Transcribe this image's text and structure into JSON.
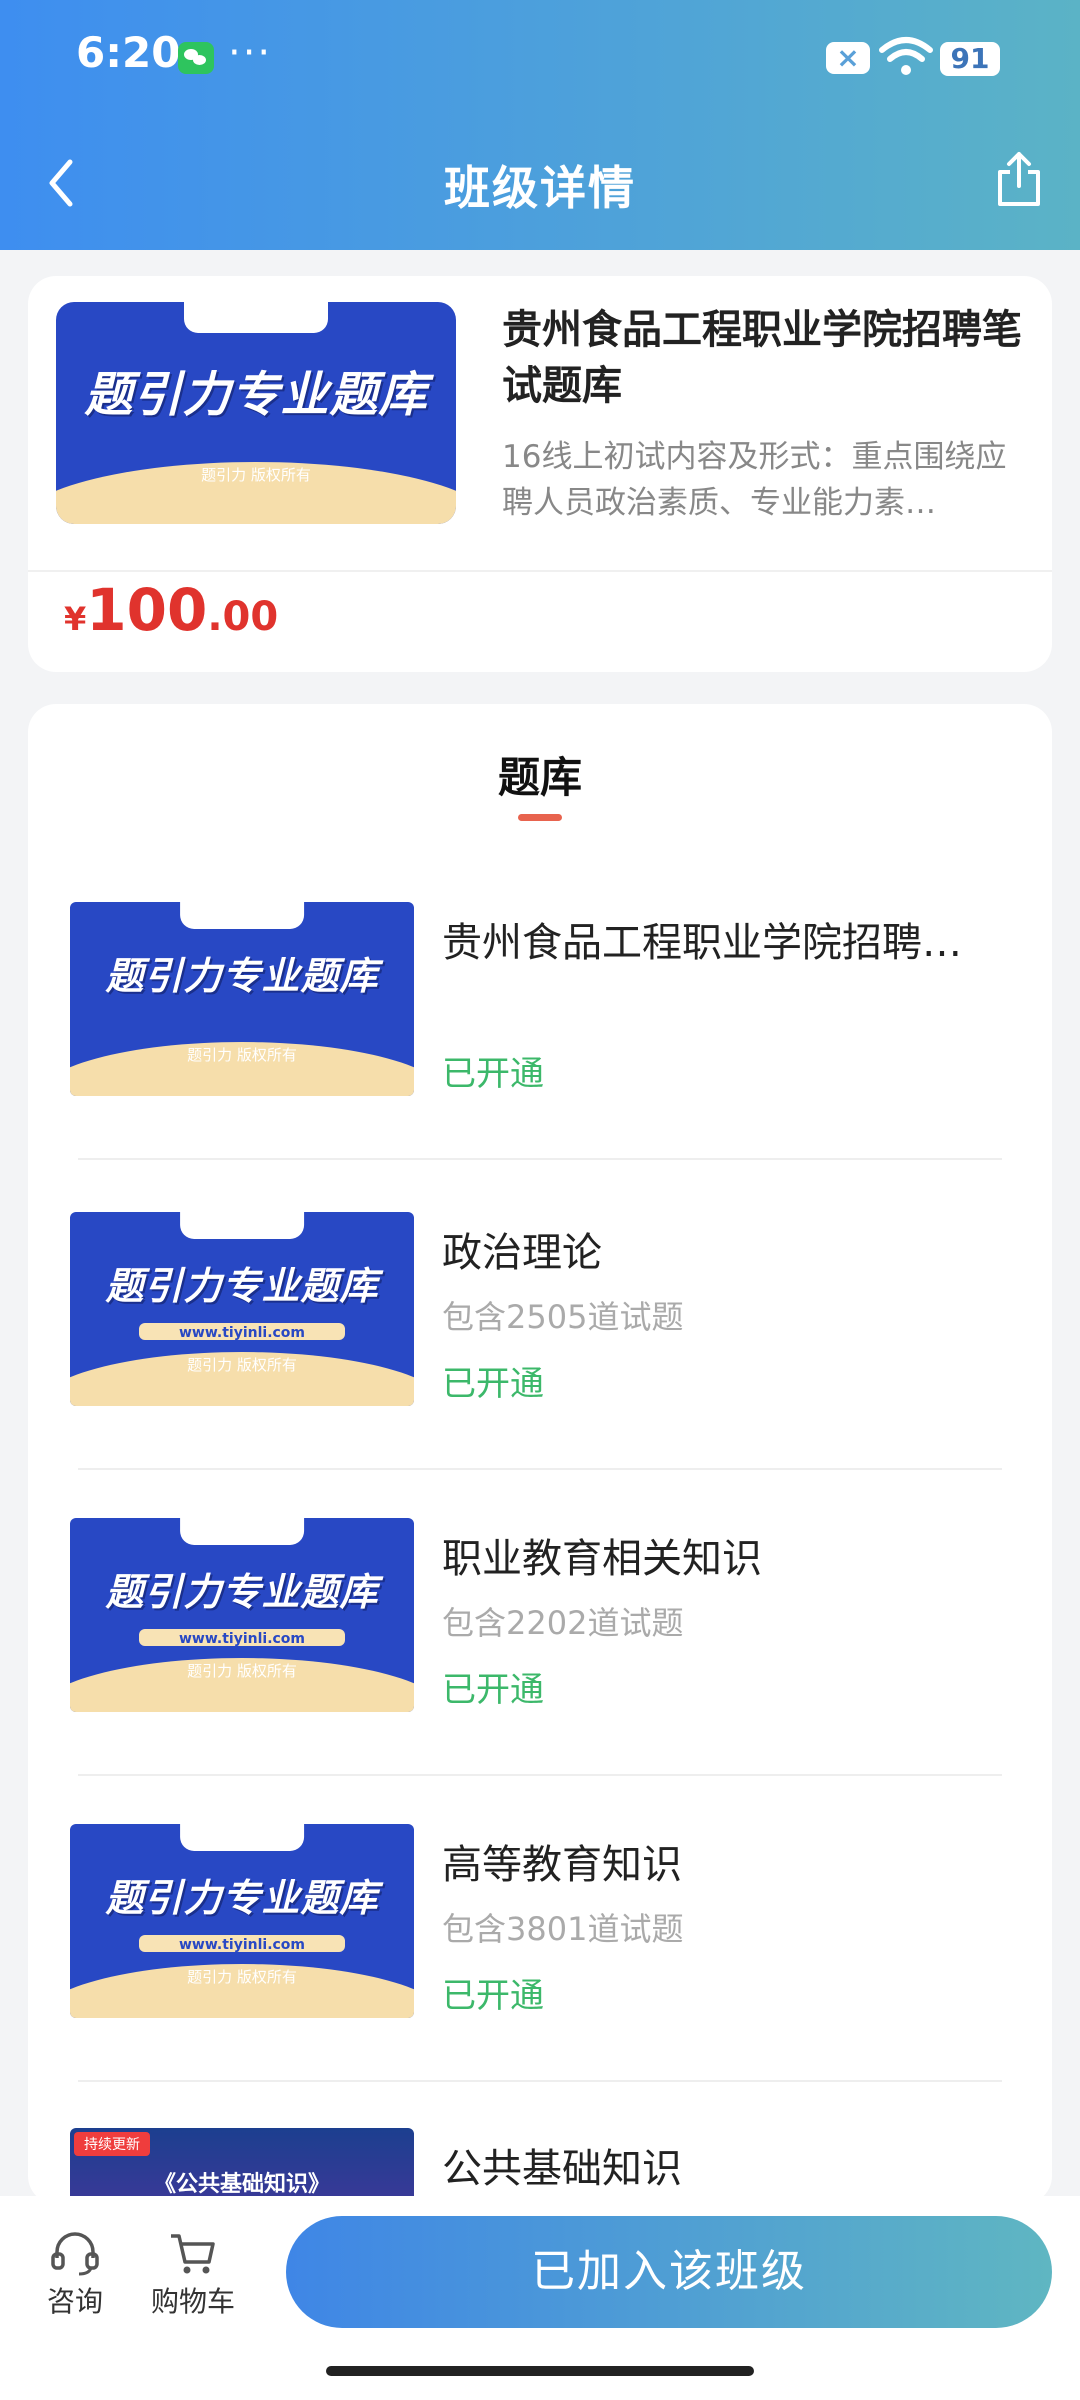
{
  "status_bar": {
    "time": "6:20",
    "more": "···",
    "battery": "91",
    "icons": [
      "wechat-icon",
      "close-badge-icon",
      "wifi-icon",
      "battery-icon"
    ]
  },
  "header": {
    "title": "班级详情",
    "icons": [
      "back-arrow-icon",
      "share-icon"
    ]
  },
  "product": {
    "thumb_text": "题引力专业题库",
    "thumb_copyright": "题引力 版权所有",
    "title": "贵州食品工程职业学院招聘笔试题库",
    "description": "16线上初试内容及形式：重点围绕应聘人员政治素质、专业能力素…",
    "price_symbol": "¥",
    "price_int": "100",
    "price_dec": ".00"
  },
  "bank": {
    "tab_label": "题库",
    "items": [
      {
        "title": "贵州食品工程职业学院招聘…",
        "count": "",
        "status": "已开通",
        "thumb_text": "题引力专业题库",
        "thumb_url": "",
        "thumb_copyright": "题引力 版权所有"
      },
      {
        "title": "政治理论",
        "count": "包含2505道试题",
        "status": "已开通",
        "thumb_text": "题引力专业题库",
        "thumb_url": "www.tiyinli.com",
        "thumb_copyright": "题引力 版权所有"
      },
      {
        "title": "职业教育相关知识",
        "count": "包含2202道试题",
        "status": "已开通",
        "thumb_text": "题引力专业题库",
        "thumb_url": "www.tiyinli.com",
        "thumb_copyright": "题引力 版权所有"
      },
      {
        "title": "高等教育知识",
        "count": "包含3801道试题",
        "status": "已开通",
        "thumb_text": "题引力专业题库",
        "thumb_url": "www.tiyinli.com",
        "thumb_copyright": "题引力 版权所有"
      },
      {
        "title": "公共基础知识",
        "count": "",
        "status": "",
        "thumb_text": "《公共基础知识》",
        "thumb_tag": "持续更新"
      }
    ]
  },
  "bottom_bar": {
    "consult_label": "咨询",
    "cart_label": "购物车",
    "join_label": "已加入该班级"
  },
  "colors": {
    "header_gradient_start": "#3e8ef0",
    "header_gradient_end": "#5bb3c6",
    "price": "#e0332d",
    "status_green": "#3cb86a",
    "tab_underline": "#e8634e",
    "thumb_blue": "#2848c4"
  }
}
